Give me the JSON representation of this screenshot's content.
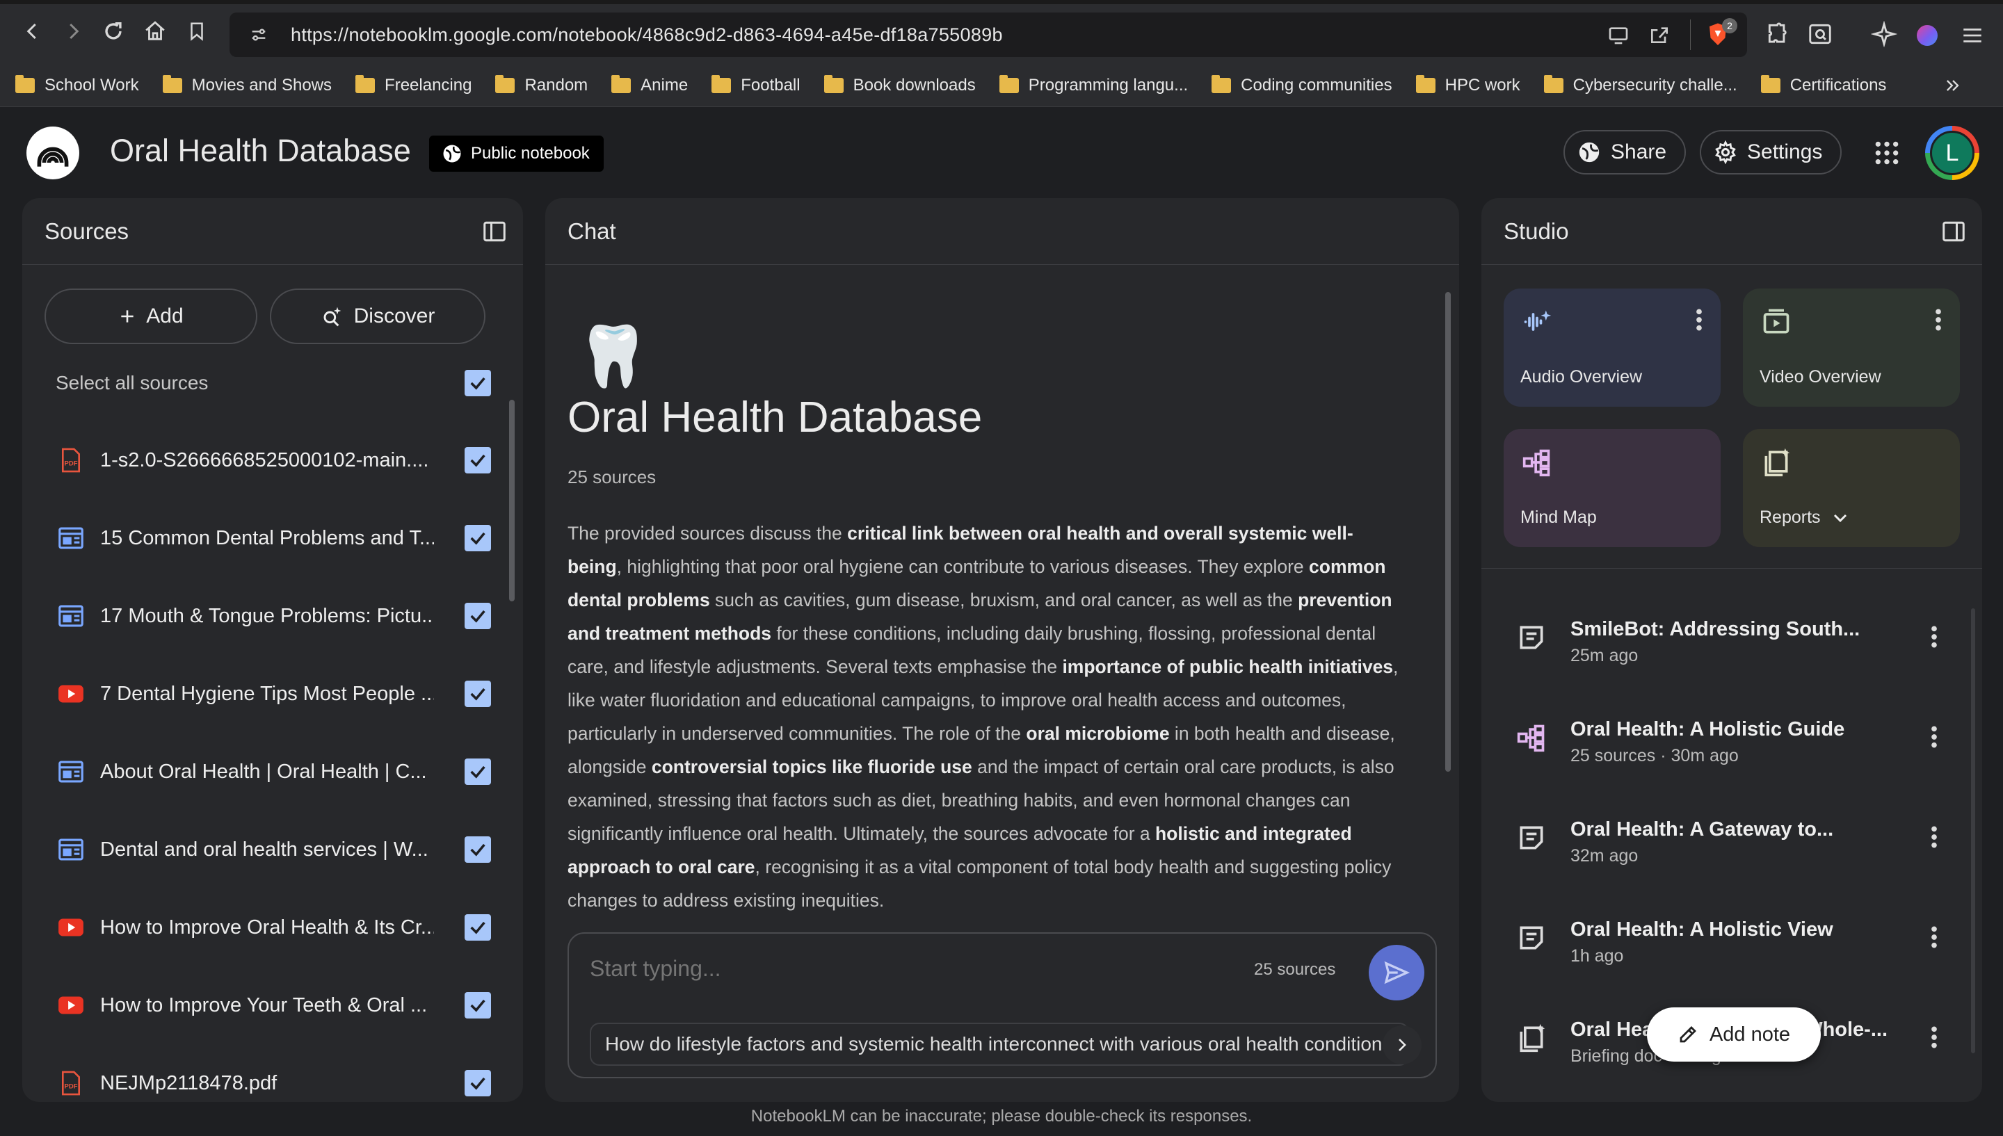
{
  "browser": {
    "url": "https://notebooklm.google.com/notebook/4868c9d2-d863-4694-a45e-df18a755089b",
    "shields_count": "2",
    "bookmarks": [
      "School Work",
      "Movies and Shows",
      "Freelancing",
      "Random",
      "Anime",
      "Football",
      "Book downloads",
      "Programming langu...",
      "Coding communities",
      "HPC work",
      "Cybersecurity challe...",
      "Certifications"
    ]
  },
  "header": {
    "title": "Oral Health Database",
    "badge": "Public notebook",
    "share_label": "Share",
    "settings_label": "Settings",
    "avatar_initial": "L"
  },
  "sources": {
    "title": "Sources",
    "add_label": "Add",
    "discover_label": "Discover",
    "select_all": "Select all sources",
    "items": [
      {
        "label": "1-s2.0-S2666668525000102-main....",
        "type": "pdf"
      },
      {
        "label": "15 Common Dental Problems and T...",
        "type": "web"
      },
      {
        "label": "17 Mouth & Tongue Problems: Pictu...",
        "type": "web"
      },
      {
        "label": "7 Dental Hygiene Tips Most People ...",
        "type": "youtube"
      },
      {
        "label": "About Oral Health | Oral Health | C...",
        "type": "web"
      },
      {
        "label": "Dental and oral health services | W...",
        "type": "web"
      },
      {
        "label": "How to Improve Oral Health & Its Cr...",
        "type": "youtube"
      },
      {
        "label": "How to Improve Your Teeth & Oral ...",
        "type": "youtube"
      },
      {
        "label": "NEJMp2118478.pdf",
        "type": "pdf"
      }
    ]
  },
  "chat": {
    "title": "Chat",
    "emoji": "🦷",
    "notebook_title": "Oral Health Database",
    "source_count": "25 sources",
    "summary": [
      {
        "t": "The provided sources discuss the ",
        "b": false
      },
      {
        "t": "critical link between oral health and overall systemic well-being",
        "b": true
      },
      {
        "t": ", highlighting that poor oral hygiene can contribute to various diseases. They explore ",
        "b": false
      },
      {
        "t": "common dental problems",
        "b": true
      },
      {
        "t": " such as cavities, gum disease, bruxism, and oral cancer, as well as the ",
        "b": false
      },
      {
        "t": "prevention and treatment methods",
        "b": true
      },
      {
        "t": " for these conditions, including daily brushing, flossing, professional dental care, and lifestyle adjustments. Several texts emphasise the ",
        "b": false
      },
      {
        "t": "importance of public health initiatives",
        "b": true
      },
      {
        "t": ", like water fluoridation and educational campaigns, to improve oral health access and outcomes, particularly in underserved communities. The role of the ",
        "b": false
      },
      {
        "t": "oral microbiome",
        "b": true
      },
      {
        "t": " in both health and disease, alongside ",
        "b": false
      },
      {
        "t": "controversial topics like fluoride use",
        "b": true
      },
      {
        "t": " and the impact of certain oral care products, is also examined, stressing that factors such as diet, breathing habits, and even hormonal changes can significantly influence oral health. Ultimately, the sources advocate for a ",
        "b": false
      },
      {
        "t": "holistic and integrated approach to oral care",
        "b": true
      },
      {
        "t": ", recognising it as a vital component of total body health and suggesting policy changes to address existing inequities.",
        "b": false
      }
    ],
    "input_placeholder": "Start typing...",
    "input_sources": "25 sources",
    "suggestion": "How do lifestyle factors and systemic health interconnect with various oral health conditions?"
  },
  "studio": {
    "title": "Studio",
    "cards": [
      {
        "label": "Audio Overview",
        "icon": "audio-waveform-icon"
      },
      {
        "label": "Video Overview",
        "icon": "video-play-icon"
      },
      {
        "label": "Mind Map",
        "icon": "mind-map-icon"
      },
      {
        "label": "Reports",
        "icon": "report-sparkle-icon"
      }
    ],
    "notes": [
      {
        "title": "SmileBot: Addressing South...",
        "sub": "25m ago",
        "icon": "note-icon"
      },
      {
        "title": "Oral Health: A Holistic Guide",
        "sub": "25 sources · 30m ago",
        "icon": "mind-map-icon"
      },
      {
        "title": "Oral Health: A Gateway to...",
        "sub": "32m ago",
        "icon": "note-icon"
      },
      {
        "title": "Oral Health: A Holistic View",
        "sub": "1h ago",
        "icon": "note-icon"
      },
      {
        "title": "Oral Health: Gateway to Whole-...",
        "sub": "Briefing doc · 1h ago",
        "icon": "report-sparkle-icon"
      }
    ],
    "add_note_label": "Add note"
  },
  "footer": {
    "disclaimer": "NotebookLM can be inaccurate; please double-check its responses."
  },
  "colors": {
    "background": "#1e1f22",
    "panel": "#27282b",
    "accent": "#a8c7fa",
    "send_button": "#5b6fcf"
  }
}
